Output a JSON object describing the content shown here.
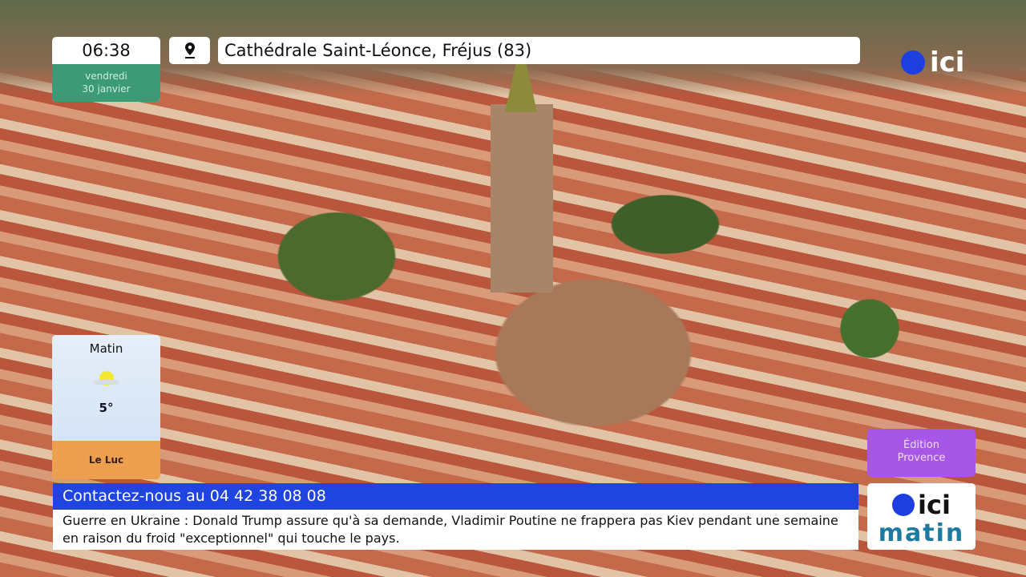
{
  "clock": {
    "time": "06:38",
    "day": "vendredi",
    "date": "30 janvier"
  },
  "location": {
    "icon": "map-pin-icon",
    "label": "Cathédrale Saint-Léonce, Fréjus (83)"
  },
  "channel_logo": {
    "text": "ici"
  },
  "weather": {
    "title": "Matin",
    "icon": "sun-cloud-icon",
    "temperature": "5°",
    "town": "Le Luc"
  },
  "edition": {
    "line1": "Édition",
    "line2": "Provence"
  },
  "ticker": {
    "headline": "Contactez-nous au 04 42 38 08 08",
    "text": "Guerre en Ukraine : Donald Trump assure qu'à sa demande, Vladimir Poutine ne frappera pas Kiev pendant une semaine en raison du froid \"exceptionnel\" qui touche le pays."
  },
  "program_logo": {
    "brand": "ici",
    "show": "matin"
  },
  "colors": {
    "accent": "#1f44e0",
    "clock_green": "#3d9a76",
    "edition_purple": "#a657e6",
    "weather_orange": "#ec9f4f"
  }
}
